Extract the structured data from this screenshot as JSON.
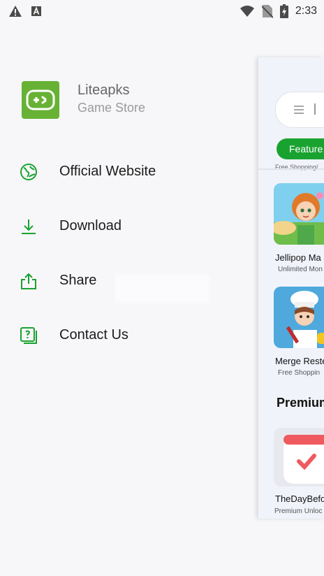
{
  "status_bar": {
    "time": "2:33",
    "left_icons": [
      "warning-icon",
      "app-a-icon"
    ],
    "right_icons": [
      "wifi-icon",
      "no-sim-icon",
      "battery-charging-icon"
    ]
  },
  "drawer": {
    "app_name": "Liteapks",
    "app_subtitle": "Game Store",
    "logo_color": "#67b234",
    "accent_color": "#1aa231",
    "menu": [
      {
        "label": "Official Website",
        "icon": "globe-icon"
      },
      {
        "label": "Download",
        "icon": "download-icon"
      },
      {
        "label": "Share",
        "icon": "share-icon"
      },
      {
        "label": "Contact Us",
        "icon": "help-icon"
      }
    ]
  },
  "preview": {
    "chip_label": "Feature",
    "cut_text": "Free Shopping/",
    "apps": [
      {
        "title": "Jellipop Ma",
        "desc": "Unlimited Mon"
      },
      {
        "title": "Merge Reste",
        "desc": "Free Shoppin"
      }
    ],
    "section_title": "Premium",
    "premium_app": {
      "title": "TheDayBefo",
      "desc": "Premium Unloc"
    }
  }
}
